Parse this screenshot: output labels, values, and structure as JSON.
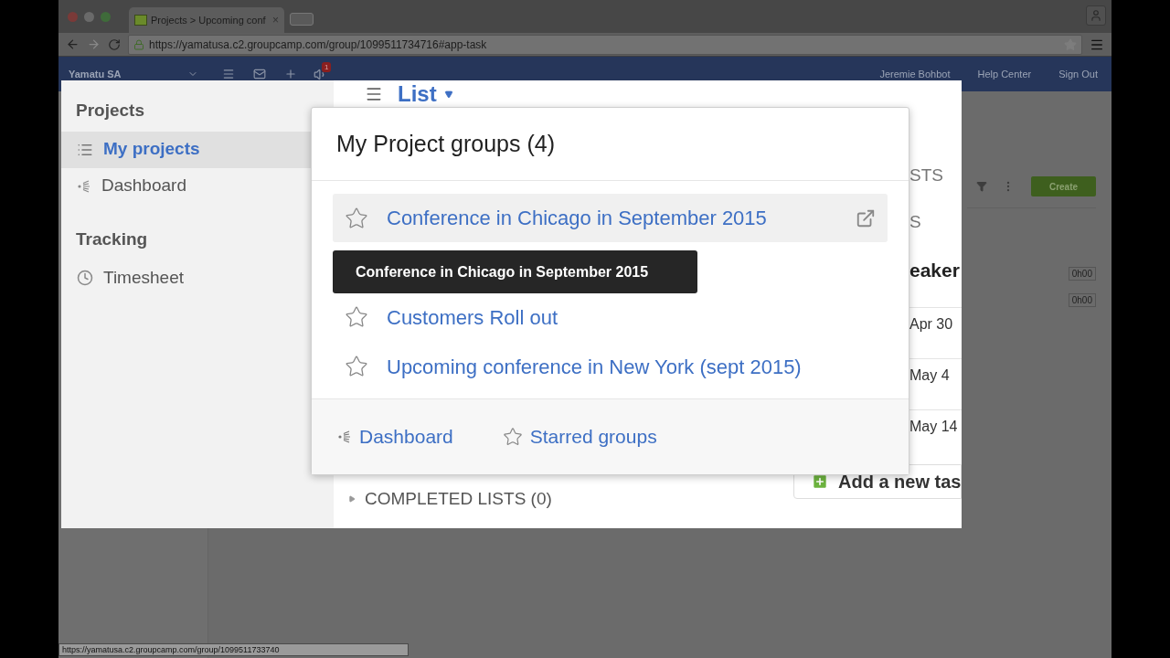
{
  "browser": {
    "tab_title": "Projects > Upcoming conf",
    "tab_close": "×",
    "url": "https://yamatusa.c2.groupcamp.com/group/1099511734716#app-task",
    "status_url": "https://yamatusa.c2.groupcamp.com/group/1099511733740"
  },
  "nav": {
    "org": "Yamatu SA",
    "badge": "1",
    "links": [
      "Jeremie Bohbot",
      "Help Center",
      "Sign Out"
    ]
  },
  "sidebar": {
    "sections": [
      {
        "title": "Projects",
        "items": [
          {
            "label": "My projects",
            "kind": "list",
            "selected": true
          },
          {
            "label": "Dashboard",
            "kind": "dashboard",
            "selected": false
          }
        ]
      },
      {
        "title": "Tracking",
        "items": [
          {
            "label": "Timesheet",
            "kind": "clock",
            "selected": false
          }
        ]
      }
    ]
  },
  "content": {
    "view": "List",
    "fragments": [
      {
        "text": "STS",
        "kind": "heading"
      },
      {
        "text": "S",
        "kind": "heading"
      },
      {
        "text": "eaker",
        "kind": "title"
      },
      {
        "text": "Apr 30",
        "kind": "date"
      },
      {
        "text": "May 4",
        "kind": "date"
      },
      {
        "text": "May 14",
        "kind": "date"
      }
    ],
    "add_task": "Add a new tas",
    "completed": "COMPLETED LISTS (0)"
  },
  "popup": {
    "title": "My Project groups (4)",
    "groups": [
      {
        "name": "Conference in Chicago in September 2015",
        "starred": false,
        "hovered": true
      },
      {
        "name": "Customers Roll out",
        "starred": false,
        "hovered": false
      },
      {
        "name": "Upcoming conference in New York (sept 2015)",
        "starred": false,
        "hovered": false
      }
    ],
    "tooltip": "Conference in Chicago in September 2015",
    "footer": [
      {
        "label": "Dashboard",
        "kind": "dashboard"
      },
      {
        "label": "Starred groups",
        "kind": "star"
      }
    ]
  },
  "toolbar": {
    "create": "Create",
    "times": [
      "0h00",
      "0h00"
    ]
  }
}
